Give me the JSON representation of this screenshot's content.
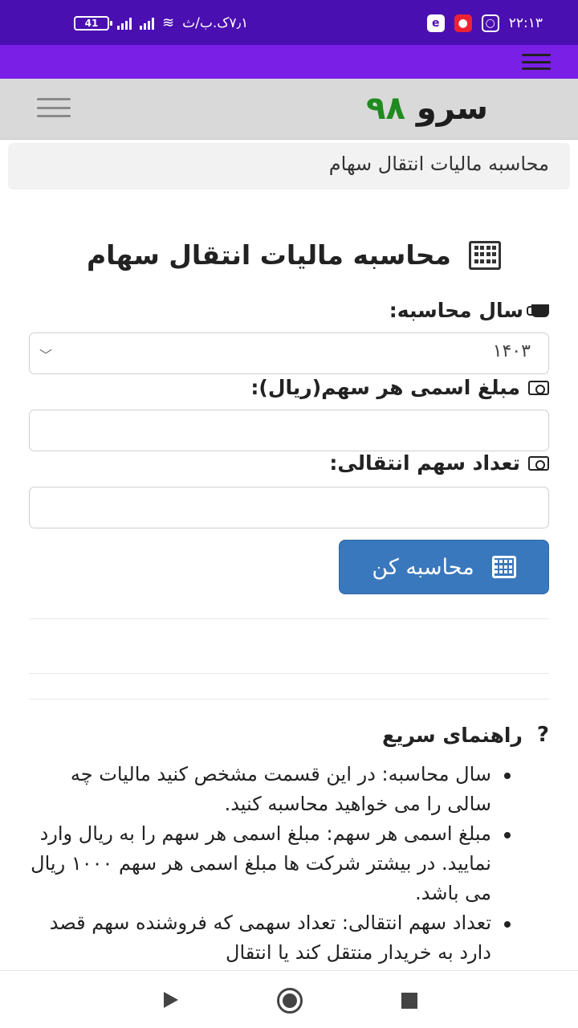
{
  "status_bar": {
    "time": "۲۲:۱۳",
    "speed": "۷٫۱ک.ب/ث",
    "battery": "41"
  },
  "site": {
    "logo_word": "سرو",
    "logo_number": "۹۸"
  },
  "breadcrumb": "محاسبه مالیات انتقال سهام",
  "page": {
    "title": "محاسبه مالیات انتقال سهام"
  },
  "form": {
    "year_label": "سال محاسبه:",
    "year_value": "۱۴۰۳",
    "nominal_label": "مبلغ اسمی هر سهم(ریال):",
    "nominal_value": "",
    "count_label": "تعداد سهم انتقالی:",
    "count_value": "",
    "submit_label": "محاسبه کن"
  },
  "guide": {
    "title": "راهنمای سریع",
    "items": [
      "سال محاسبه: در این قسمت مشخص کنید مالیات چه سالی را می خواهید محاسبه کنید.",
      "مبلغ اسمی هر سهم: مبلغ اسمی هر سهم را به ریال وارد نمایید. در بیشتر شرکت ها مبلغ اسمی هر سهم ۱۰۰۰ ریال می باشد.",
      "تعداد سهم انتقالی: تعداد سهمی که فروشنده سهم قصد دارد به خریدار منتقل کند یا انتقال"
    ]
  }
}
